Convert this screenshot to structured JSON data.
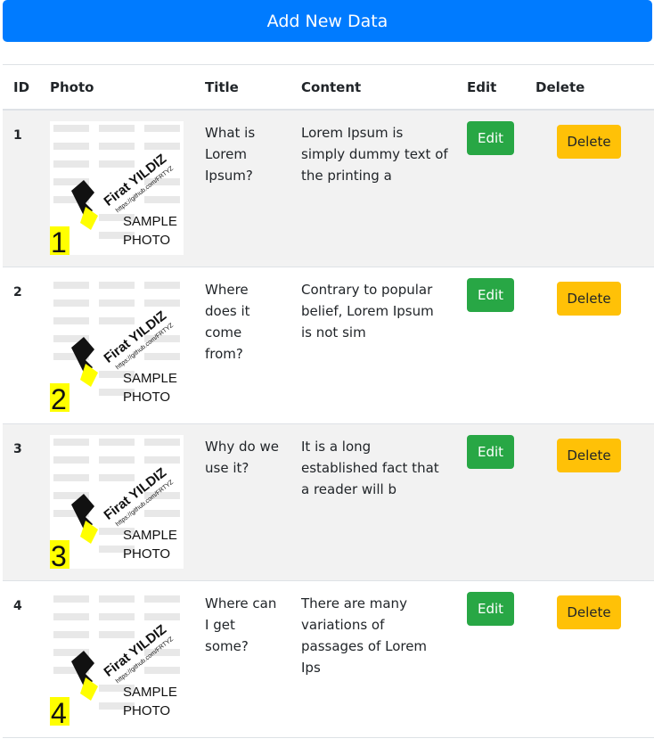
{
  "header": {
    "add_label": "Add New Data"
  },
  "table": {
    "columns": {
      "id": "ID",
      "photo": "Photo",
      "title": "Title",
      "content": "Content",
      "edit": "Edit",
      "delete": "Delete"
    },
    "rows": [
      {
        "id": "1",
        "title": "What is Lorem Ipsum?",
        "content": "Lorem Ipsum is simply dummy text of the printing a",
        "edit": "Edit",
        "delete": "Delete",
        "photo": {
          "name": "Firat YILDIZ",
          "url": "https://github.com/FRTYZ",
          "caption1": "SAMPLE",
          "caption2": "PHOTO",
          "number": "1"
        }
      },
      {
        "id": "2",
        "title": "Where does it come from?",
        "content": "Contrary to popular belief, Lorem Ipsum is not sim",
        "edit": "Edit",
        "delete": "Delete",
        "photo": {
          "name": "Firat YILDIZ",
          "url": "https://github.com/FRTYZ",
          "caption1": "SAMPLE",
          "caption2": "PHOTO",
          "number": "2"
        }
      },
      {
        "id": "3",
        "title": "Why do we use it?",
        "content": "It is a long established fact that a reader will b",
        "edit": "Edit",
        "delete": "Delete",
        "photo": {
          "name": "Firat YILDIZ",
          "url": "https://github.com/FRTYZ",
          "caption1": "SAMPLE",
          "caption2": "PHOTO",
          "number": "3"
        }
      },
      {
        "id": "4",
        "title": "Where can I get some?",
        "content": "There are many variations of passages of Lorem Ips",
        "edit": "Edit",
        "delete": "Delete",
        "photo": {
          "name": "Firat YILDIZ",
          "url": "https://github.com/FRTYZ",
          "caption1": "SAMPLE",
          "caption2": "PHOTO",
          "number": "4"
        }
      }
    ]
  },
  "colors": {
    "primary": "#007bff",
    "success": "#28a745",
    "warning": "#ffc107",
    "stripe": "#f2f2f2",
    "photo_highlight": "#ffff00"
  }
}
